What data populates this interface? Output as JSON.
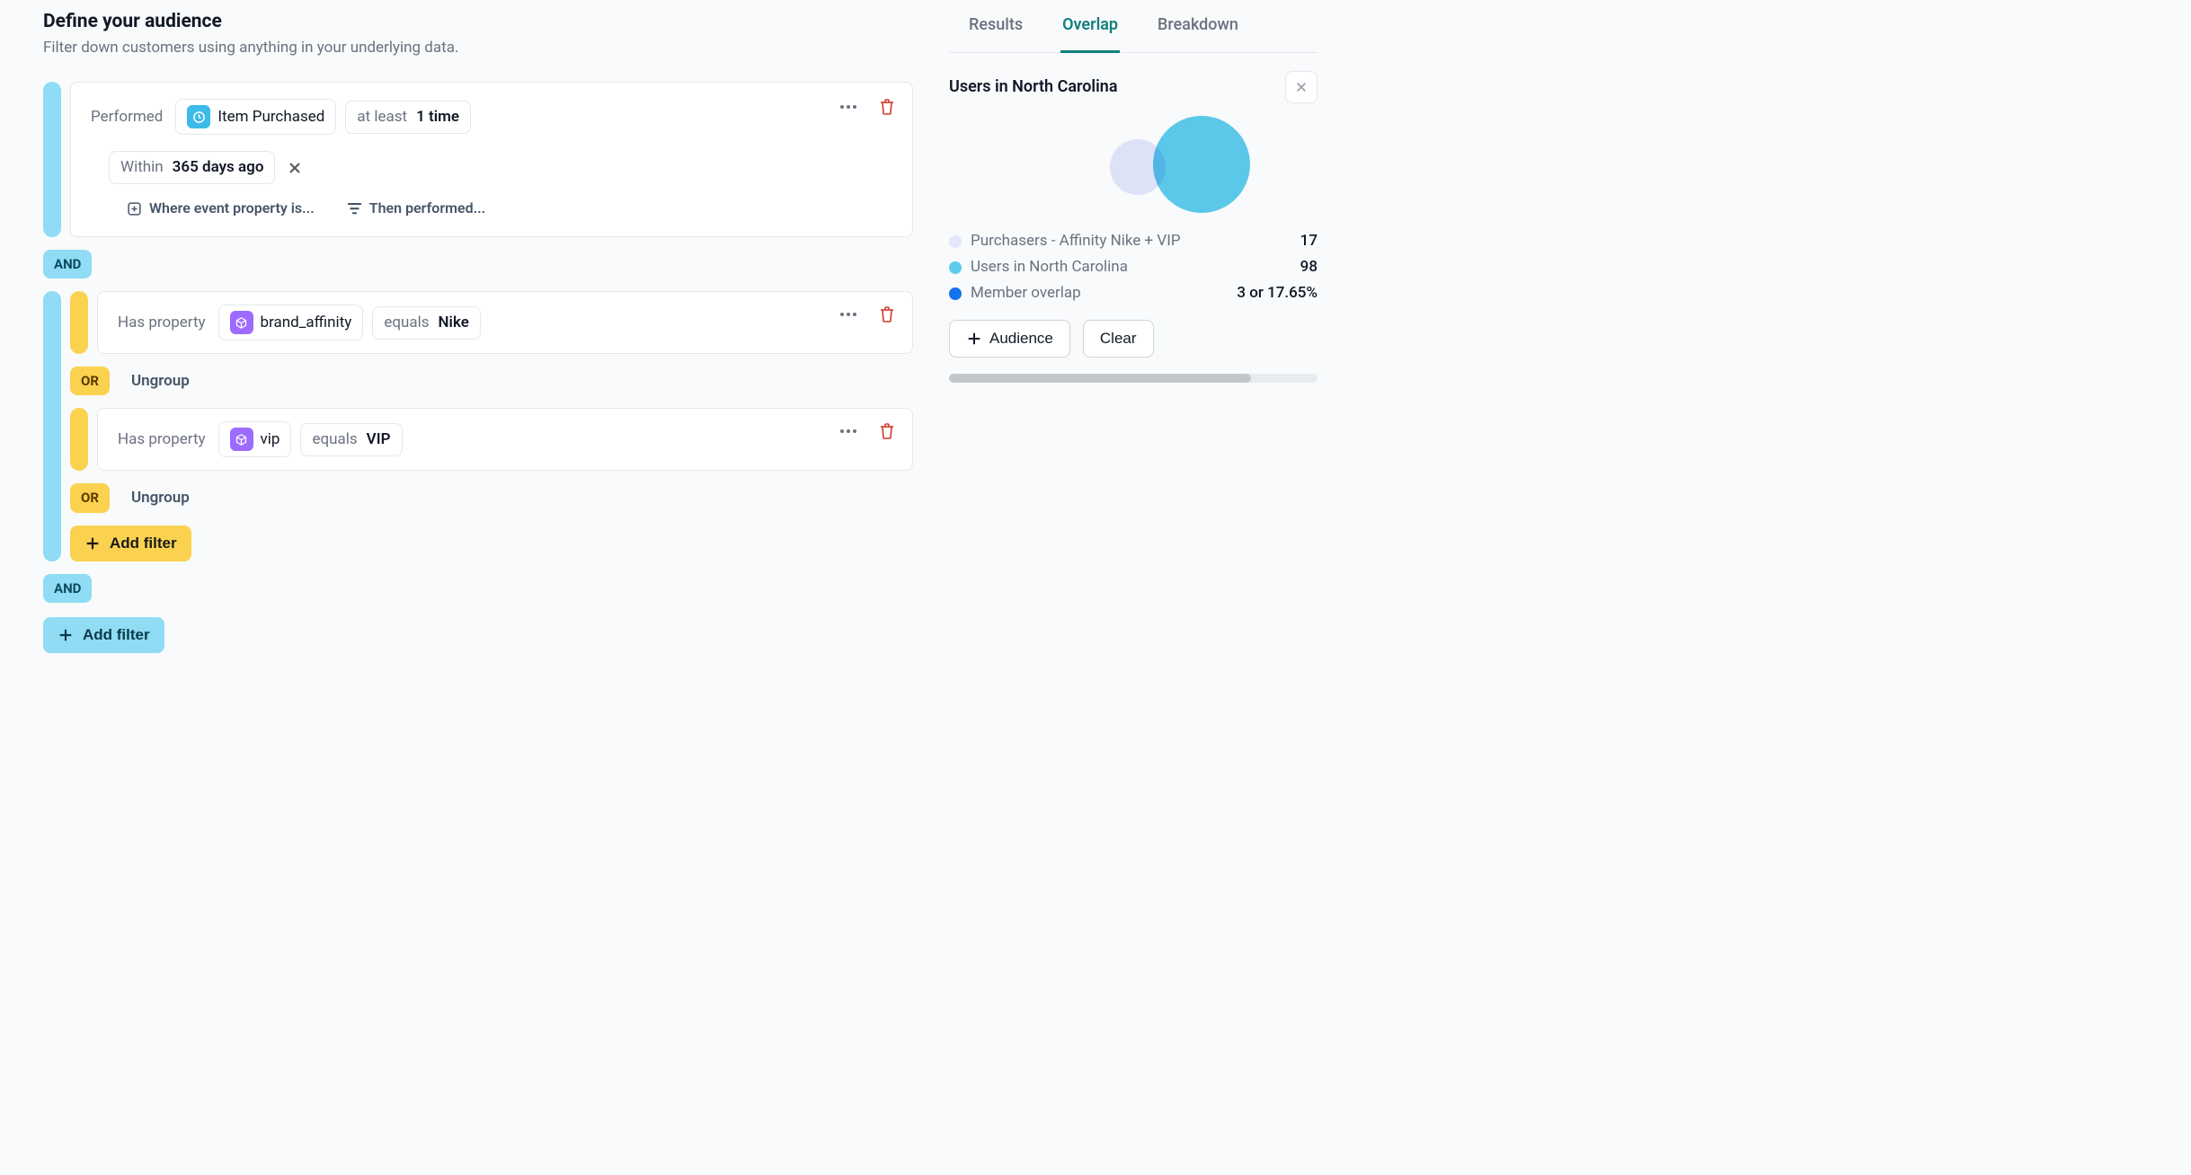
{
  "header": {
    "title": "Define your audience",
    "subtitle": "Filter down customers using anything in your underlying data."
  },
  "event_card": {
    "performed_label": "Performed",
    "event_name": "Item Purchased",
    "freq_prefix": "at least",
    "freq_value": "1 time",
    "time_prefix": "Within",
    "time_value": "365 days ago",
    "where_event_property": "Where event property is...",
    "then_performed": "Then performed..."
  },
  "connectors": {
    "and": "AND",
    "or": "OR",
    "ungroup": "Ungroup"
  },
  "prop_cards": {
    "has_property_label": "Has property",
    "equals_label": "equals",
    "p1_name": "brand_affinity",
    "p1_value": "Nike",
    "p2_name": "vip",
    "p2_value": "VIP"
  },
  "buttons": {
    "add_filter": "Add filter",
    "audience": "Audience",
    "clear": "Clear"
  },
  "tabs": {
    "results": "Results",
    "overlap": "Overlap",
    "breakdown": "Breakdown"
  },
  "panel": {
    "title": "Users in North Carolina",
    "legend": [
      {
        "label": "Purchasers - Affinity Nike + VIP",
        "value": "17"
      },
      {
        "label": "Users in North Carolina",
        "value": "98"
      },
      {
        "label": "Member overlap",
        "value": "3 or 17.65%"
      }
    ]
  },
  "chart_data": {
    "type": "venn",
    "title": "Users in North Carolina",
    "sets": [
      {
        "name": "Purchasers - Affinity Nike + VIP",
        "size": 17,
        "color": "#e4e7fb"
      },
      {
        "name": "Users in North Carolina",
        "size": 98,
        "color": "#5dcced"
      }
    ],
    "overlap": {
      "label": "Member overlap",
      "count": 3,
      "percent": 17.65,
      "color": "#1472eb"
    }
  }
}
